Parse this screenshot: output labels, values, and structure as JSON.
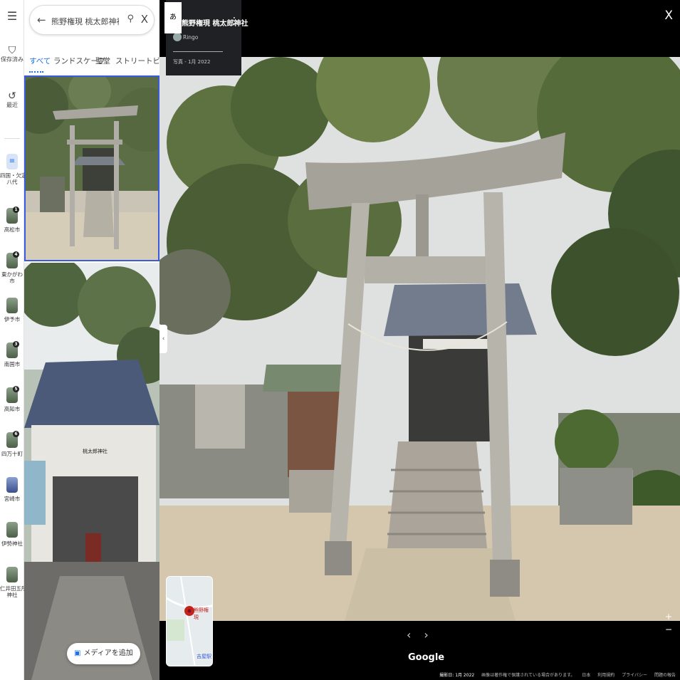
{
  "rail": {
    "menu_icon": "hamburger-icon",
    "saved": {
      "icon": "bookmark-icon",
      "label": "保存済み"
    },
    "recent": {
      "icon": "history-icon",
      "label": "最近"
    },
    "places": [
      {
        "label": "四国・欠定\n八代",
        "badge": ""
      },
      {
        "label": "高松市",
        "badge": "1"
      },
      {
        "label": "東かがわ市",
        "badge": "4"
      },
      {
        "label": "伊予市",
        "badge": ""
      },
      {
        "label": "南国市",
        "badge": "3"
      },
      {
        "label": "高知市",
        "badge": "5"
      },
      {
        "label": "四万十町",
        "badge": "6"
      },
      {
        "label": "宮崎市",
        "badge": ""
      },
      {
        "label": "伊勢神社",
        "badge": ""
      },
      {
        "label": "仁井田五所\n神社",
        "badge": ""
      }
    ]
  },
  "panel": {
    "search_query": "熊野権現 桃太郎神社",
    "tabs": [
      "すべて",
      "ランドスケープ",
      "聖堂",
      "ストリートビューと"
    ],
    "add_media": "メディアを追加",
    "photo2_sign": "桃太郎神社"
  },
  "viewer": {
    "title": "熊野権現 桃太郎神社",
    "author": "Ringo",
    "date": "写真 - 1月 2022",
    "badge": "あ",
    "minimap_label": "熊野権現",
    "minimap_label2": "吉屋駅",
    "brand": "Google",
    "footer": {
      "capture": "撮影日: 1月 2022",
      "copyright": "画像は著作権で保護されている場合があります。",
      "links": [
        "日本",
        "利用規約",
        "プライバシー",
        "問題の報告"
      ]
    }
  },
  "colors": {
    "accent": "#1a73e8",
    "selected_border": "#3b5bdb"
  }
}
